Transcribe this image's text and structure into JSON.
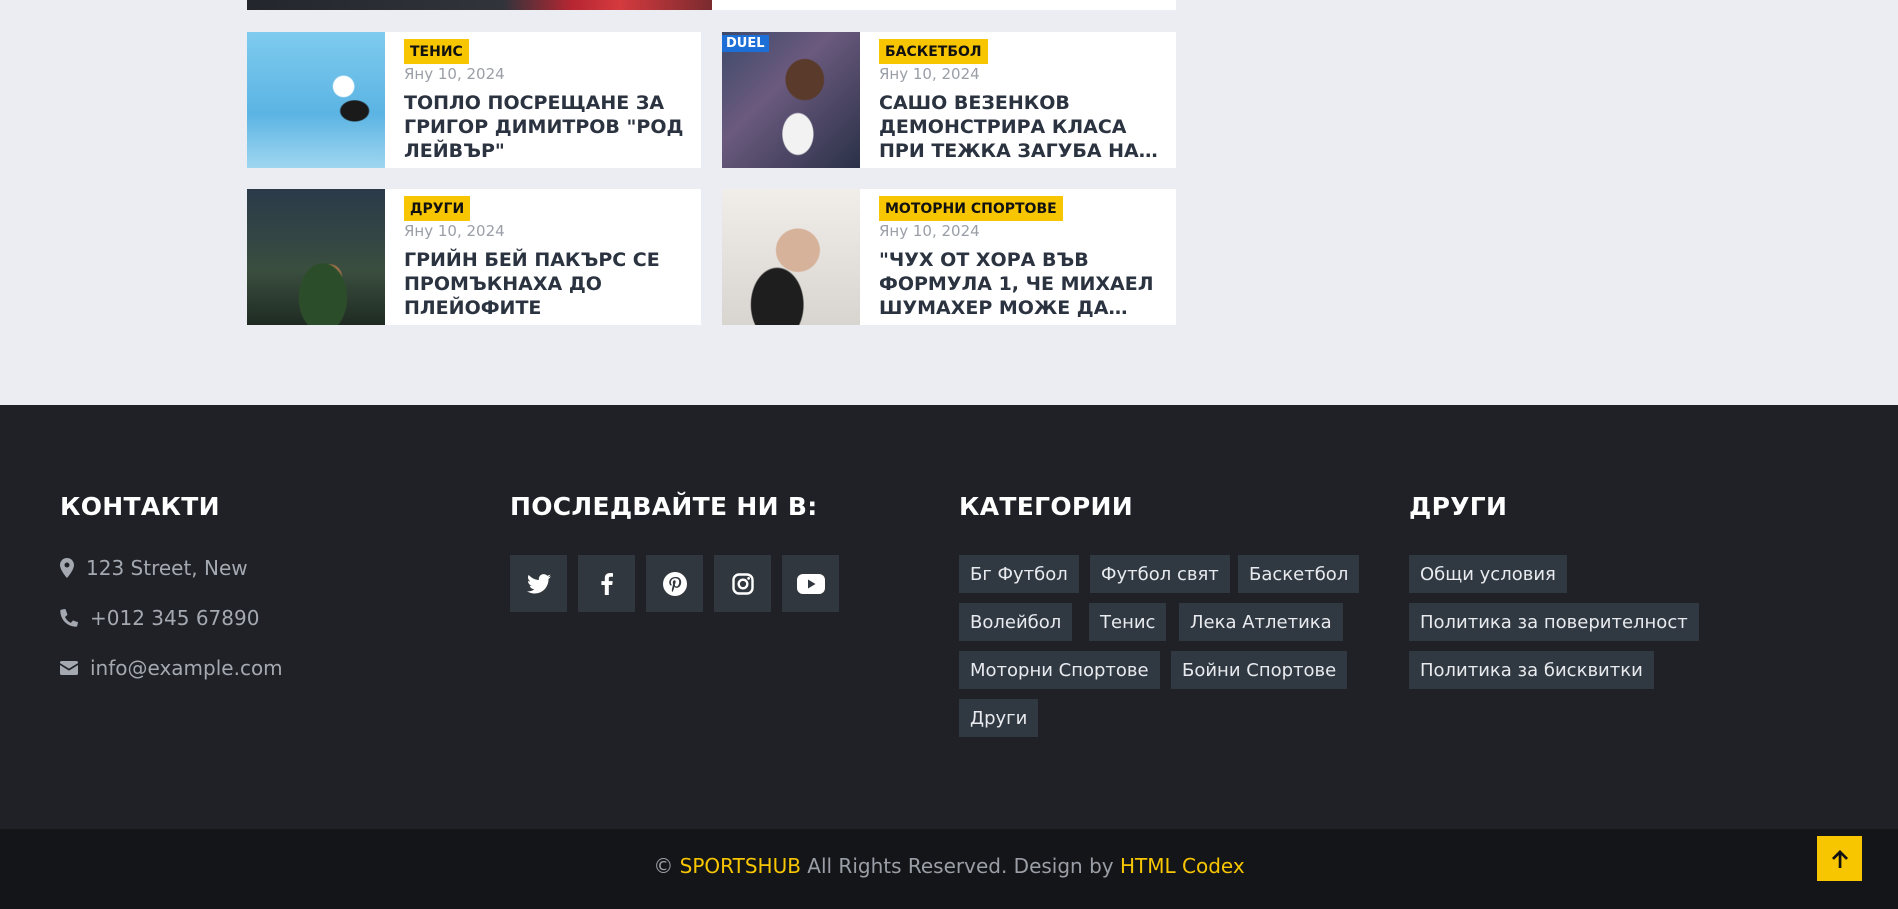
{
  "news_cards": [
    {
      "category": "ТЕНИС",
      "date": "Яну 10, 2024",
      "title": "ТОПЛО ПОСРЕЩАНЕ ЗА ГРИГОР ДИМИТРОВ \"РОД ЛЕЙВЪР\""
    },
    {
      "category": "БАСКЕТБОЛ",
      "date": "Яну 10, 2024",
      "title": "САШО ВЕЗЕНКОВ ДЕМОНСТРИРА КЛАСА ПРИ ТЕЖКА ЗАГУБА НА…",
      "image_badge": "DUEL"
    },
    {
      "category": "ДРУГИ",
      "date": "Яну 10, 2024",
      "title": "ГРИЙН БЕЙ ПАКЪРС СЕ ПРОМЪКНАХА ДО ПЛЕЙОФИТЕ"
    },
    {
      "category": "МОТОРНИ СПОРТОВЕ",
      "date": "Яну 10, 2024",
      "title": "\"ЧУХ ОТ ХОРА ВЪВ ФОРМУЛА 1, ЧЕ МИХАЕЛ ШУМАХЕР МОЖЕ ДА…"
    }
  ],
  "footer": {
    "contacts": {
      "heading": "КОНТАКТИ",
      "address": "123 Street, New",
      "phone": "+012 345 67890",
      "email": "info@example.com"
    },
    "follow": {
      "heading": "ПОСЛЕДВАЙТЕ НИ В:",
      "networks": [
        "twitter-icon",
        "facebook-icon",
        "pinterest-icon",
        "instagram-icon",
        "youtube-icon"
      ]
    },
    "categories": {
      "heading": "КАТЕГОРИИ",
      "items": [
        "Бг Футбол",
        "Футбол свят",
        "Баскетбол",
        "Волейбол",
        "Тенис",
        "Лека Атлетика",
        "Моторни Спортове",
        "Бойни Спортове",
        "Други"
      ]
    },
    "others": {
      "heading": "ДРУГИ",
      "items": [
        "Общи условия",
        "Политика за поверителност",
        "Политика за бисквитки"
      ]
    }
  },
  "copyright": {
    "symbol": "©",
    "brand": "SPORTSHUB",
    "text": "All Rights Reserved. Design by",
    "designer": "HTML Codex"
  },
  "colors": {
    "accent": "#f7c600",
    "footer_bg": "#1f2126",
    "bottom_bg": "#141518",
    "tag_bg": "#303942",
    "page_bg": "#ecedf2"
  }
}
